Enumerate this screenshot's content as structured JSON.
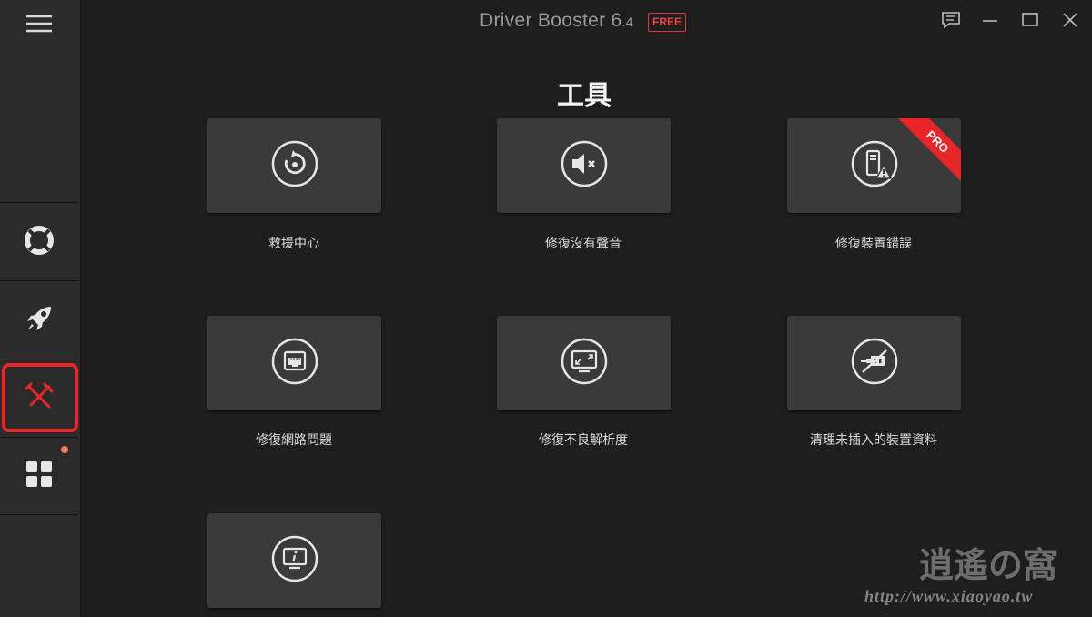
{
  "titlebar": {
    "app_name": "Driver Booster 6",
    "version": ".4",
    "badge": "FREE"
  },
  "sidebar": {
    "items": [
      {
        "icon": "hamburger-menu-icon"
      },
      {
        "icon": "lifebuoy-icon"
      },
      {
        "icon": "rocket-icon"
      },
      {
        "icon": "tools-icon",
        "active": true
      },
      {
        "icon": "apps-grid-icon",
        "notification": true
      }
    ]
  },
  "main": {
    "title": "工具",
    "tools": [
      {
        "label": "救援中心",
        "icon": "rescue-restore-icon"
      },
      {
        "label": "修復沒有聲音",
        "icon": "sound-mute-icon"
      },
      {
        "label": "修復裝置錯誤",
        "icon": "device-error-icon",
        "badge": "PRO"
      },
      {
        "label": "修復網路問題",
        "icon": "network-port-icon"
      },
      {
        "label": "修復不良解析度",
        "icon": "monitor-resolution-icon"
      },
      {
        "label": "清理未插入的裝置資料",
        "icon": "unplugged-device-icon"
      },
      {
        "label": "",
        "icon": "system-info-icon"
      }
    ]
  },
  "watermark": {
    "logo_text": "逍遙の窩",
    "url": "http://www.xiaoyao.tw"
  },
  "colors": {
    "background": "#1e1e1e",
    "sidebar": "#2b2b2b",
    "tile": "#3a3a3a",
    "accent_red": "#e8262a"
  }
}
